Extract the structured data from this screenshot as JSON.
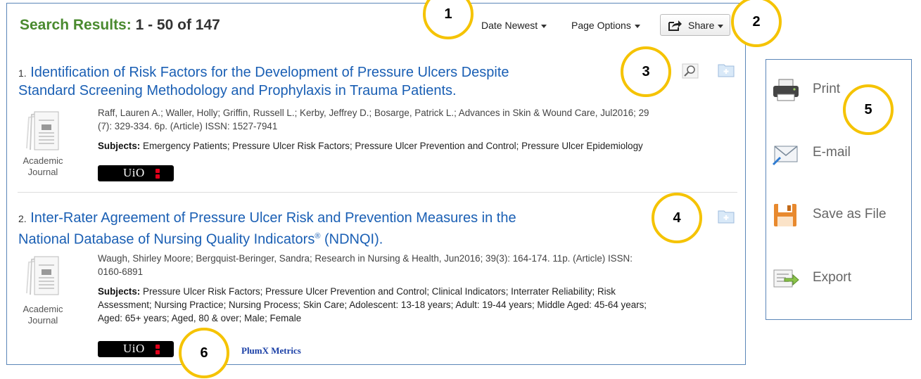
{
  "results_header": {
    "label": "Search Results:",
    "range": "1 - 50 of 147"
  },
  "toolbar": {
    "sort_label": "Date Newest",
    "page_options_label": "Page Options",
    "share_label": "Share",
    "share_icon": "share-arrow-icon"
  },
  "results": [
    {
      "number": "1.",
      "title_line1": "Identification of Risk Factors for the Development of Pressure Ulcers Despite",
      "title_line2": "Standard Screening Methodology and Prophylaxis in Trauma Patients.",
      "authors_line1": "Raff, Lauren A.; Waller, Holly; Griffin, Russell L.; Kerby, Jeffrey D.; Bosarge, Patrick L.; Advances in Skin & Wound Care, Jul2016; 29",
      "authors_line2": "(7): 329-334. 6p. (Article) ISSN: 1527-7941",
      "subjects_label": "Subjects:",
      "subjects_line1": "Emergency Patients; Pressure Ulcer Risk Factors; Pressure Ulcer Prevention and Control; Pressure Ulcer Epidemiology",
      "type_line1": "Academic",
      "type_line2": "Journal",
      "badge": "UiO"
    },
    {
      "number": "2.",
      "title_line1": "Inter-Rater Agreement of Pressure Ulcer Risk and Prevention Measures in the",
      "title_line2": "National Database of Nursing Quality Indicators",
      "title_reg": "®",
      "title_suffix": " (NDNQI).",
      "authors_line1": "Waugh, Shirley Moore; Bergquist-Beringer, Sandra; Research in Nursing & Health, Jun2016; 39(3): 164-174. 11p. (Article) ISSN:",
      "authors_line2": "0160-6891",
      "subjects_label": "Subjects:",
      "subjects_line1": "Pressure Ulcer Risk Factors; Pressure Ulcer Prevention and Control; Clinical Indicators; Interrater Reliability; Risk",
      "subjects_line2": "Assessment; Nursing Practice; Nursing Process; Skin Care; Adolescent: 13-18 years; Adult: 19-44 years; Middle Aged: 45-64 years;",
      "subjects_line3": "Aged: 65+ years; Aged, 80 & over; Male; Female",
      "type_line1": "Academic",
      "type_line2": "Journal",
      "badge": "UiO",
      "plumx": "PlumX Metrics"
    }
  ],
  "share_menu": {
    "items": [
      {
        "label": "Print",
        "icon": "printer-icon"
      },
      {
        "label": "E-mail",
        "icon": "envelope-icon"
      },
      {
        "label": "Save as File",
        "icon": "floppy-disk-icon"
      },
      {
        "label": "Export",
        "icon": "export-icon"
      }
    ]
  },
  "callouts": [
    "1",
    "2",
    "3",
    "4",
    "5",
    "6"
  ],
  "colors": {
    "heading_green": "#4a8a2f",
    "link_blue": "#1a5fb4",
    "callout_ring": "#f5c300",
    "panel_border": "#5b86b8"
  }
}
